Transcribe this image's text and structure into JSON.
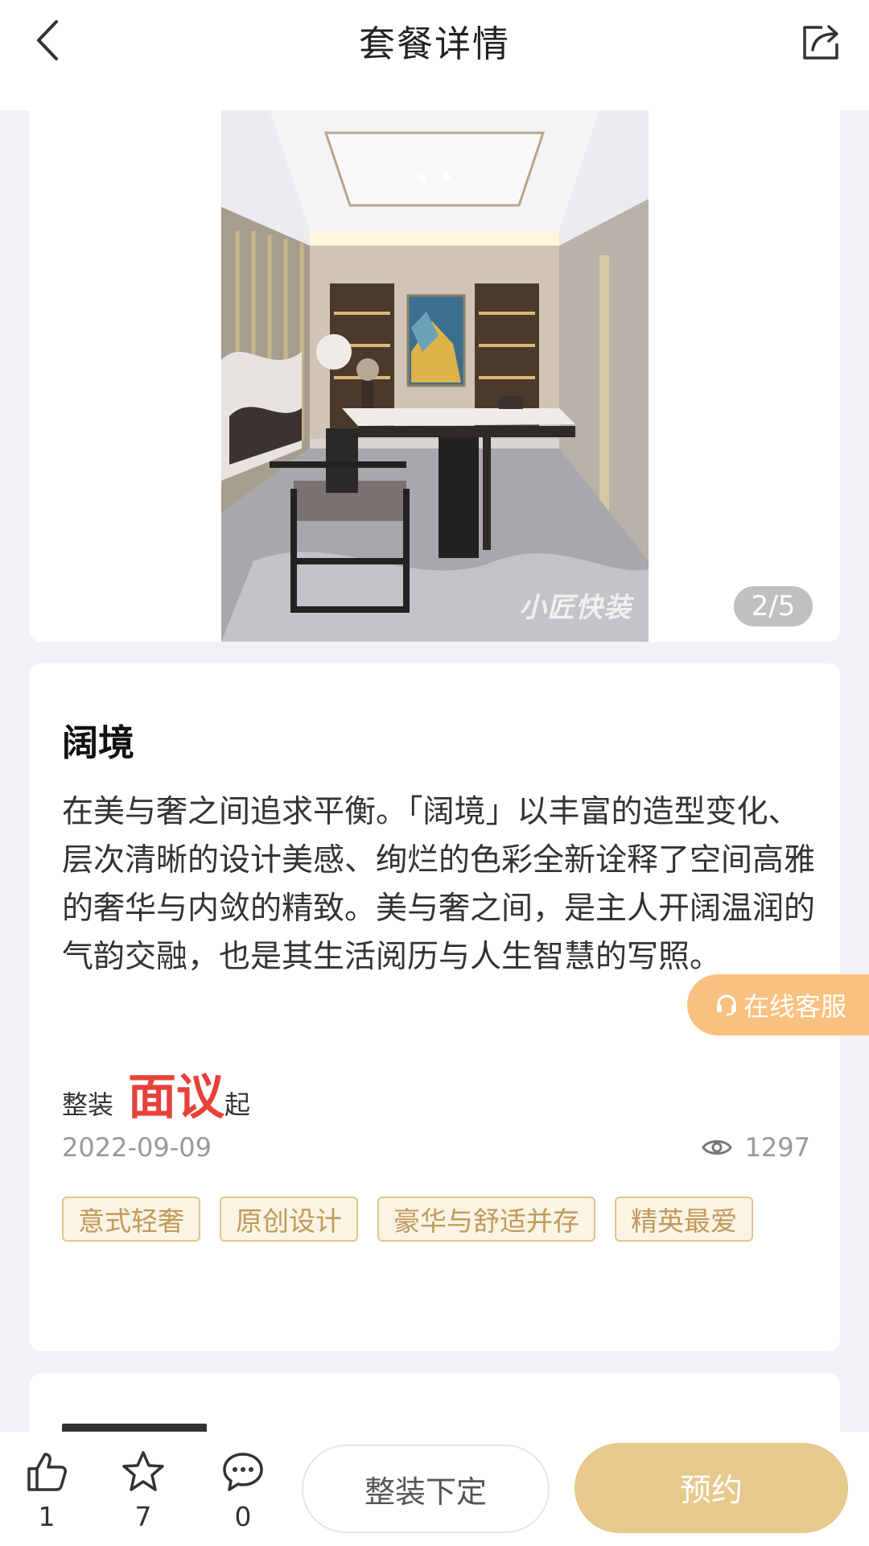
{
  "header": {
    "title": "套餐详情",
    "back_icon": "chevron-left-icon",
    "share_icon": "share-icon"
  },
  "gallery": {
    "counter": "2/5",
    "watermark": "小匠快装"
  },
  "package": {
    "name": "阔境",
    "description": "在美与奢之间追求平衡。「阔境」以丰富的造型变化、层次清晰的设计美感、绚烂的色彩全新诠释了空间高雅的奢华与内敛的精致。美与奢之间，是主人开阔温润的气韵交融，也是其生活阅历与人生智慧的写照。",
    "price_prefix": "整装",
    "price_value": "面议",
    "price_suffix": "起",
    "date": "2022-09-09",
    "views": "1297",
    "tags": [
      "意式轻奢",
      "原创设计",
      "豪华与舒适并存",
      "精英最爱"
    ]
  },
  "service": {
    "label": "在线客服"
  },
  "bottom_bar": {
    "like_count": "1",
    "favorite_count": "7",
    "comment_count": "0",
    "order_label": "整装下定",
    "book_label": "预约"
  },
  "colors": {
    "accent_gold": "#e6c98c",
    "tag_border": "#e2c48f",
    "tag_text": "#c09a5c",
    "price_red": "#e8413a",
    "service_orange": "#f9c17f"
  }
}
